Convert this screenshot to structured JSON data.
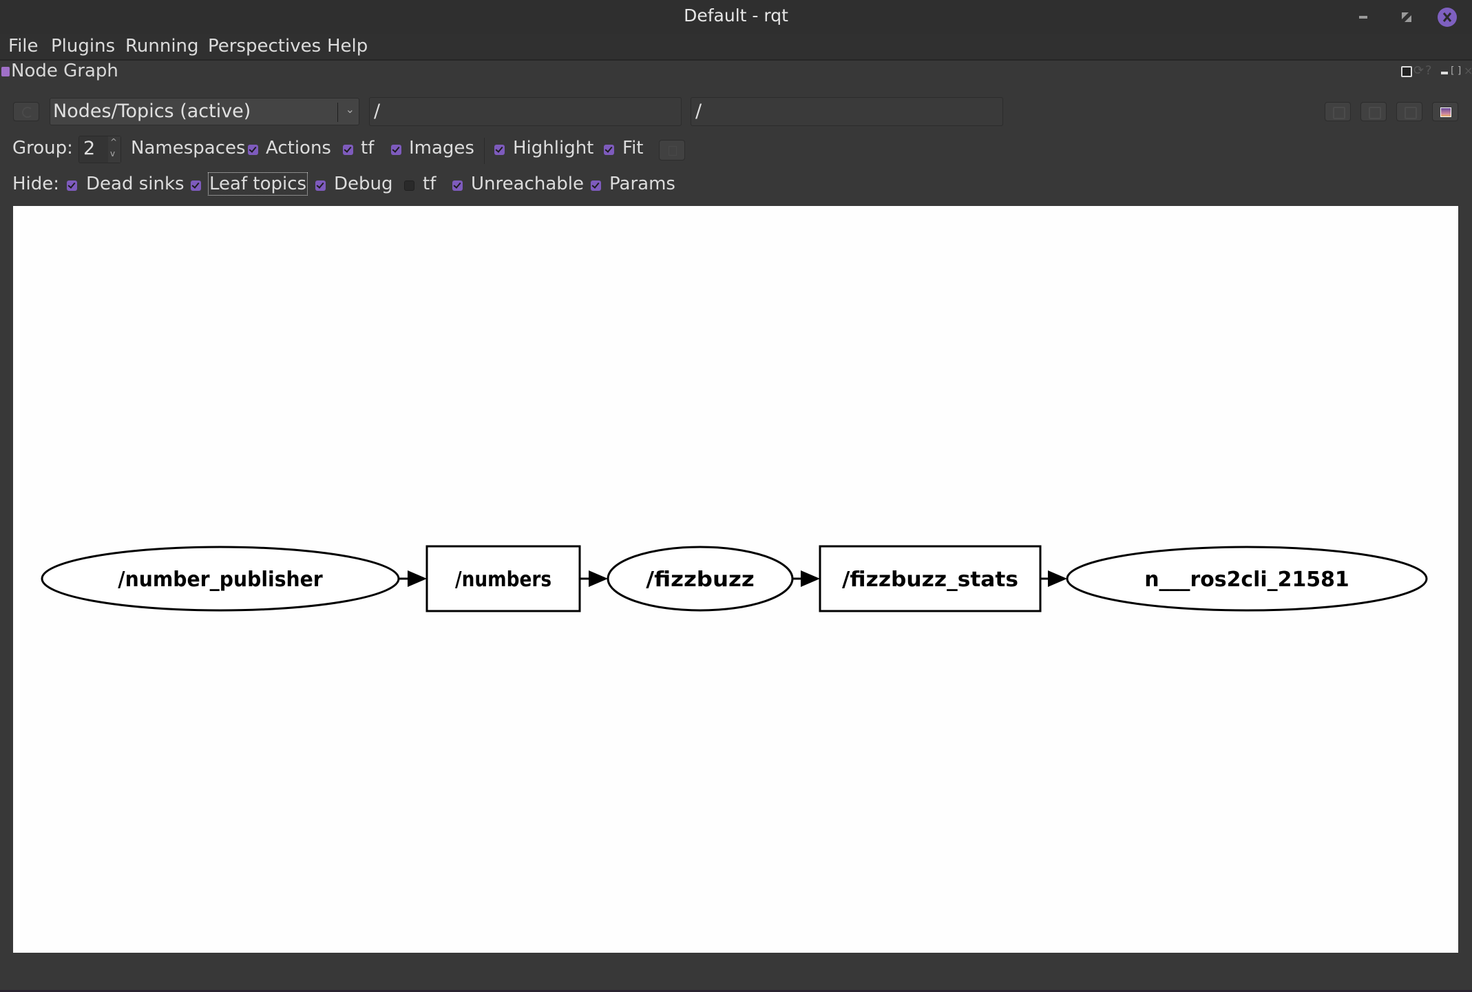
{
  "window": {
    "title": "Default - rqt",
    "controls": [
      "minimize",
      "maximize",
      "close"
    ],
    "accent_color": "#7e5bbd"
  },
  "menu": {
    "items": [
      {
        "label": "File",
        "mnemonic": "F"
      },
      {
        "label": "Plugins",
        "mnemonic": "P"
      },
      {
        "label": "Running",
        "mnemonic": "R"
      },
      {
        "label": "Perspectives",
        "mnemonic": "e"
      },
      {
        "label": "Help",
        "mnemonic": "H"
      }
    ]
  },
  "dock": {
    "title": "Node Graph",
    "controls": [
      "dock-toggle",
      "reload",
      "help",
      "minimize",
      "float",
      "close"
    ]
  },
  "toolbar": {
    "refresh_icon": "refresh-icon",
    "graph_type": "Nodes/Topics (active)",
    "node_filter": "/",
    "topic_filter": "/",
    "right_buttons": [
      "load-dot-icon",
      "save-dot-icon",
      "save-svg-icon",
      "save-image-icon"
    ]
  },
  "options": {
    "group_label": "Group:",
    "group_value": "2",
    "checks": [
      {
        "label": "Namespaces",
        "checked": false,
        "hidden_box": true
      },
      {
        "label": "Actions",
        "checked": true
      },
      {
        "label": "tf",
        "checked": true
      },
      {
        "label": "Images",
        "checked": true
      },
      {
        "label": "Highlight",
        "checked": true
      },
      {
        "label": "Fit",
        "checked": true
      }
    ],
    "fit_button_icon": "fit-in-view-icon"
  },
  "hide": {
    "label": "Hide:",
    "checks": [
      {
        "label": "Dead sinks",
        "checked": true
      },
      {
        "label": "Leaf topics",
        "checked": true,
        "focused": true
      },
      {
        "label": "Debug",
        "checked": true
      },
      {
        "label": "tf",
        "checked": false
      },
      {
        "label": "Unreachable",
        "checked": true
      },
      {
        "label": "Params",
        "checked": true
      }
    ]
  },
  "graph": {
    "nodes": [
      {
        "id": "n1",
        "label": "/number_publisher",
        "kind": "node",
        "shape": "ellipse"
      },
      {
        "id": "t1",
        "label": "/numbers",
        "kind": "topic",
        "shape": "box"
      },
      {
        "id": "n2",
        "label": "/fizzbuzz",
        "kind": "node",
        "shape": "ellipse"
      },
      {
        "id": "t2",
        "label": "/fizzbuzz_stats",
        "kind": "topic",
        "shape": "box"
      },
      {
        "id": "n3",
        "label": "n___ros2cli_21581",
        "kind": "node",
        "shape": "ellipse"
      }
    ],
    "edges": [
      {
        "from": "n1",
        "to": "t1"
      },
      {
        "from": "t1",
        "to": "n2"
      },
      {
        "from": "n2",
        "to": "t2"
      },
      {
        "from": "t2",
        "to": "n3"
      }
    ]
  }
}
